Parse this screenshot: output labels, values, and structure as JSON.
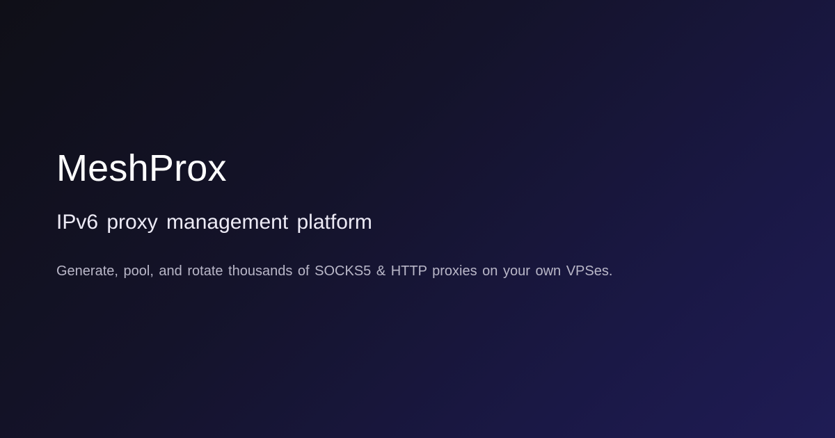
{
  "brand": {
    "name": "MeshProx",
    "tagline": "IPv6 proxy management platform",
    "description": "Generate, pool, and rotate thousands of SOCKS5 & HTTP proxies on your own VPSes."
  },
  "colors": {
    "background_start": "#0f0f17",
    "background_end": "#1f1c55",
    "title": "#ffffff",
    "subtitle": "#eceaf5",
    "description": "#b9b7c8"
  }
}
